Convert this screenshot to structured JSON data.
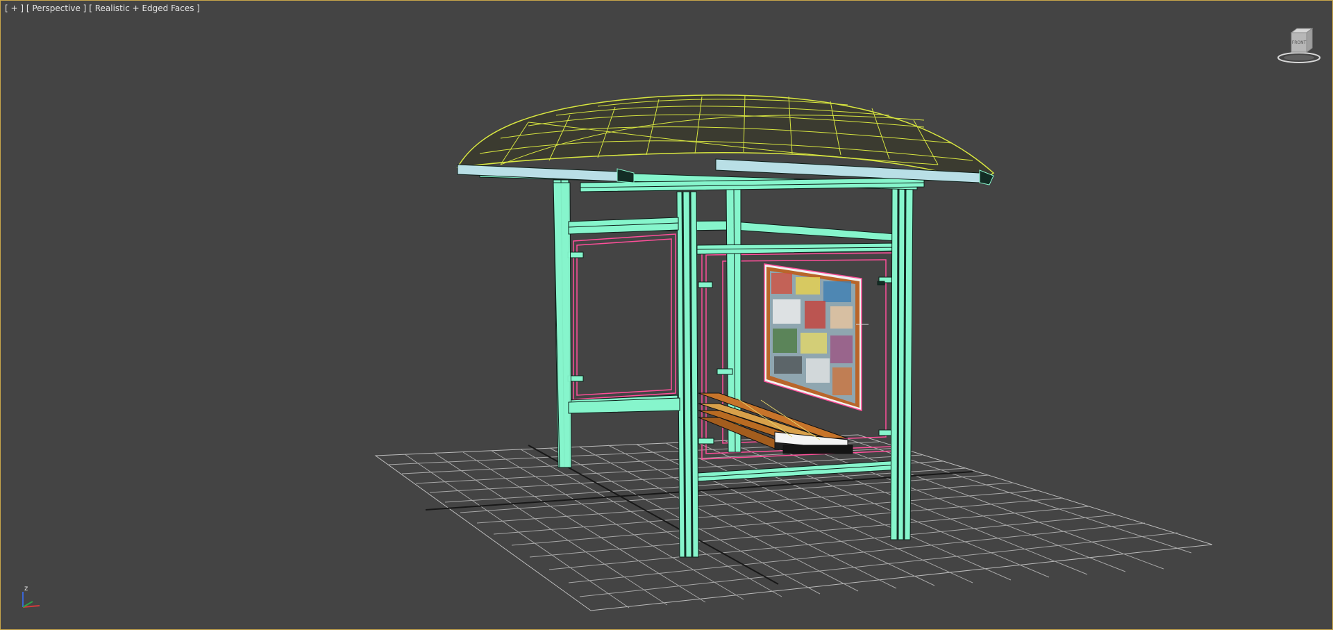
{
  "viewport": {
    "label_plus": "[ + ]",
    "label_view": "[ Perspective ]",
    "label_shading": "[ Realistic + Edged Faces ]",
    "border_color": "#c8a64a",
    "background_color": "#444444"
  },
  "viewcube": {
    "face_label": "FRONT"
  },
  "axis_tripod": {
    "z_label": "z"
  },
  "scene": {
    "object_colors": {
      "frame": "#86f5cc",
      "frame_dark": "#132d25",
      "roof_wire": "#d8e640",
      "glass_outline": "#ff4f9a",
      "bench_wood": "#b96b22",
      "grid": "#b9b9b9"
    },
    "icons": [
      "viewcube-icon",
      "axis-tripod-icon"
    ]
  }
}
